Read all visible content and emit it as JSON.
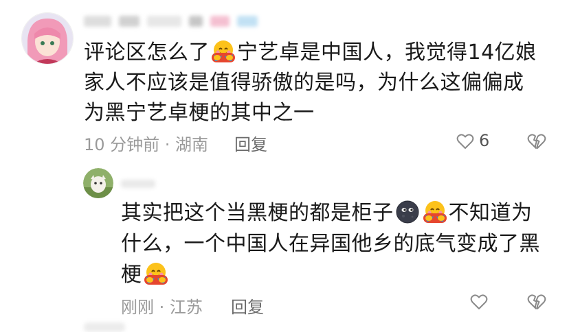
{
  "comment": {
    "text_before_emoji": "评论区怎么了",
    "emoji": "hugging-face-emoji",
    "text_after_emoji": "宁艺卓是中国人，我觉得14亿娘家人不应该是值得骄傲的是吗，为什么这偏偏成为黑宁艺卓梗的其中之一",
    "time_location": "10 分钟前 · 湖南",
    "reply_label": "回复",
    "like_count": "6"
  },
  "reply": {
    "text_part1": "其实把这个当黑梗的都是柜子",
    "emoji1": "new-moon-face-emoji",
    "emoji2": "hugging-face-emoji",
    "text_part2": "不知道为什么，一个中国人在异国他乡的底气变成了黑梗",
    "emoji3": "hugging-face-emoji",
    "time_location": "刚刚 · 江苏",
    "reply_label": "回复"
  },
  "colors": {
    "meta_gray": "#9a9a9a",
    "icon_gray": "#8a8a8a",
    "text": "#1a1a1a"
  }
}
